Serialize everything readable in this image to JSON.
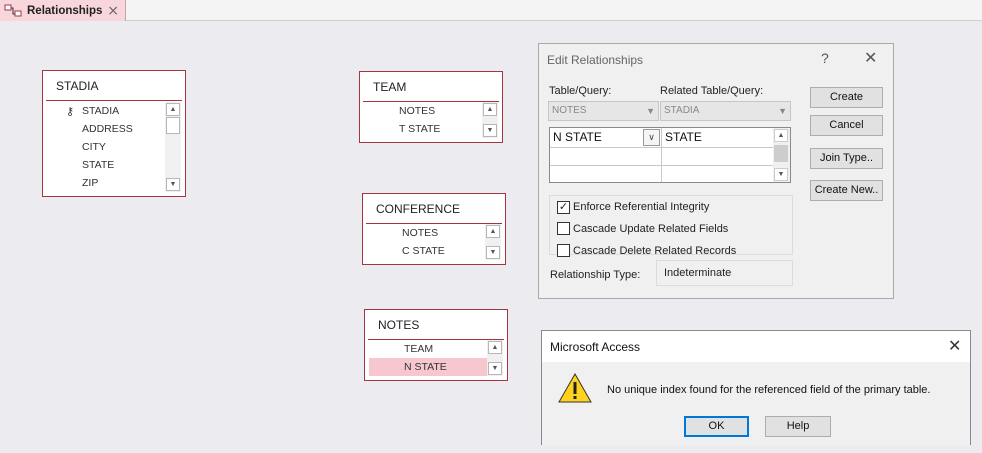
{
  "tab": {
    "label": "Relationships",
    "close": "⨯"
  },
  "tables": [
    {
      "title": "STADIA",
      "fields": [
        "STADIA",
        "ADDRESS",
        "CITY",
        "STATE",
        "ZIP"
      ]
    },
    {
      "title": "TEAM",
      "fields": [
        "NOTES",
        "T STATE"
      ]
    },
    {
      "title": "CONFERENCE",
      "fields": [
        "NOTES",
        "C STATE"
      ]
    },
    {
      "title": "NOTES",
      "fields": [
        "TEAM",
        "N STATE"
      ]
    }
  ],
  "edit_dialog": {
    "title": "Edit Relationships",
    "help": "?",
    "close": "✕",
    "table_query_label": "Table/Query:",
    "related_label": "Related Table/Query:",
    "table_value": "NOTES",
    "related_value": "STADIA",
    "grid_left": "N STATE",
    "grid_right": "STATE",
    "create": "Create",
    "cancel": "Cancel",
    "join_type": "Join Type..",
    "create_new": "Create New..",
    "enforce": "Enforce Referential Integrity",
    "cascade_update": "Cascade Update Related Fields",
    "cascade_delete": "Cascade Delete Related Records",
    "enforce_checked": true,
    "relationship_type_label": "Relationship Type:",
    "relationship_type_value": "Indeterminate"
  },
  "message_box": {
    "title": "Microsoft Access",
    "close": "✕",
    "text": "No unique index found for the referenced field of the primary table.",
    "ok": "OK",
    "help": "Help"
  }
}
